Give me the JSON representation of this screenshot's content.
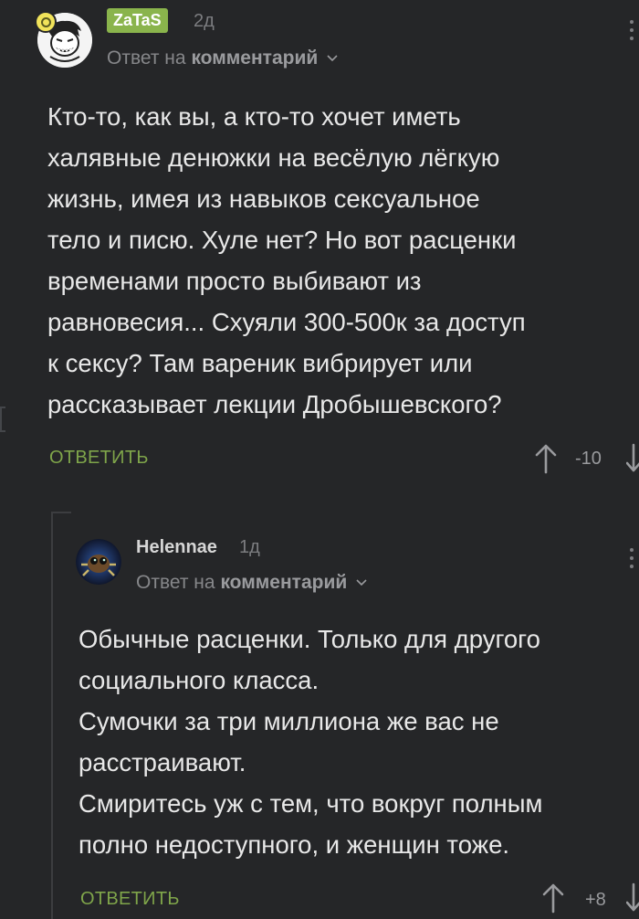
{
  "comments": [
    {
      "author": "ZaTaS",
      "time": "2д",
      "reply_prefix": "Ответ на",
      "reply_target": "комментарий",
      "text_lines": [
        "Кто-то, как вы, а кто-то хочет иметь",
        "халявные денюжки на весёлую лёгкую",
        "жизнь, имея из навыков сексуальное",
        "тело и писю. Хуле нет? Но вот расценки",
        "временами просто выбивают из",
        "равновесия... Схуяли 300-500к за доступ",
        "к сексу? Там вареник вибрирует или",
        "рассказывает лекции Дробышевского?"
      ],
      "reply_label": "ОТВЕТИТЬ",
      "rating": "-10"
    },
    {
      "author": "Helennae",
      "time": "1д",
      "reply_prefix": "Ответ на",
      "reply_target": "комментарий",
      "text_lines": [
        "Обычные расценки. Только для другого",
        "социального класса.",
        "Сумочки за три миллиона же вас не",
        "расстраивают.",
        "Смиритесь уж с тем, что вокруг полным",
        "полно недоступного, и женщин тоже."
      ],
      "reply_label": "ОТВЕТИТЬ",
      "rating": "+8"
    }
  ],
  "colors": {
    "background": "#252628",
    "author_badge": "#8ab44c",
    "reply_button": "#7fa54a"
  },
  "icons": [
    "avatar-zatas",
    "avatar-helennae",
    "chevron-down-icon",
    "arrow-up-icon",
    "arrow-down-icon",
    "more-menu-icon"
  ]
}
